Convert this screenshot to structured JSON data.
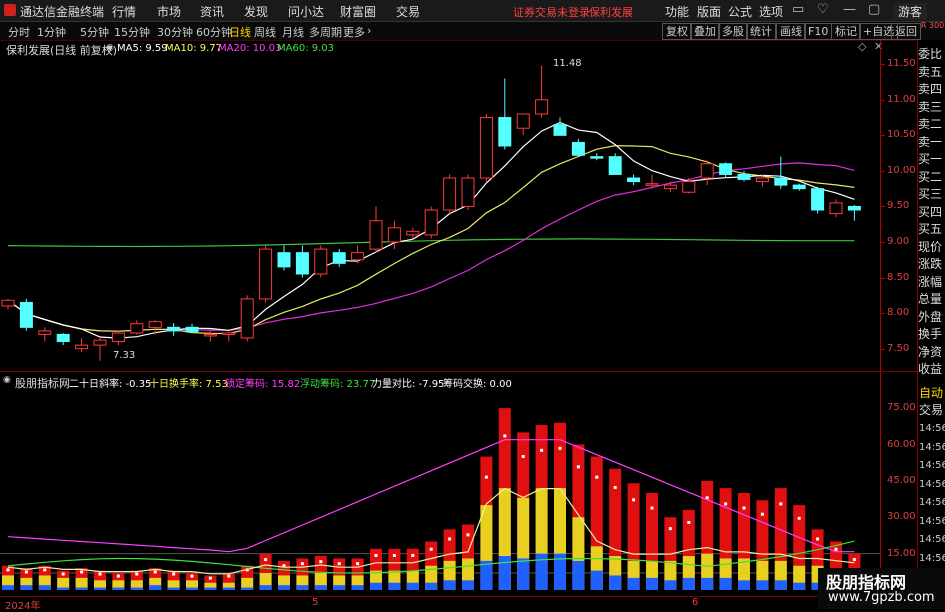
{
  "app": {
    "title": "通达信金融终端",
    "menu": [
      "行情",
      "市场",
      "资讯",
      "发现",
      "问小达",
      "财富圈",
      "交易"
    ],
    "login_warning": "证券交易未登录",
    "stock_link": "保利发展",
    "right_menu": [
      "功能",
      "版面",
      "公式",
      "选项"
    ],
    "guest": "游客",
    "win_buttons": [
      "▭",
      "♡",
      "—",
      "▢",
      "✕"
    ]
  },
  "periods": {
    "items": [
      "分时",
      "1分钟",
      "5分钟",
      "15分钟",
      "30分钟",
      "60分钟",
      "日线",
      "周线",
      "月线",
      "多周期",
      "更多"
    ],
    "active": "日线",
    "tools": [
      "复权",
      "叠加",
      "多股",
      "统计",
      "画线",
      "F10",
      "标记",
      "+自选",
      "返回"
    ],
    "corner_badge": "R 300"
  },
  "main_chart": {
    "title": "保利发展(日线 前复权)",
    "ma_labels": [
      {
        "text": "MA5: 9.59",
        "color": "#ffffff"
      },
      {
        "text": "MA10: 9.77",
        "color": "#ffff50"
      },
      {
        "text": "MA20: 10.03",
        "color": "#ff40ff"
      },
      {
        "text": "MA60: 9.03",
        "color": "#40e040"
      }
    ],
    "high_label": "11.48",
    "low_label": "7.33",
    "y_ticks": [
      "11.50",
      "11.00",
      "10.50",
      "10.00",
      "9.50",
      "9.00",
      "8.50",
      "8.00",
      "7.50"
    ]
  },
  "indicator": {
    "title": "股朋指标网",
    "items": [
      {
        "text": "二十日斜率: -0.35",
        "color": "#ffffff"
      },
      {
        "text": "十日换手率: 7.53",
        "color": "#ffff50"
      },
      {
        "text": "锁定筹码: 15.82",
        "color": "#ff40ff"
      },
      {
        "text": "浮动筹码: 23.77",
        "color": "#40e040"
      },
      {
        "text": "力量对比: -7.95",
        "color": "#ffffff"
      },
      {
        "text": "筹码交换: 0.00",
        "color": "#ffffff"
      }
    ],
    "y_ticks": [
      "75.00",
      "60.00",
      "45.00",
      "30.00",
      "15.00"
    ]
  },
  "xaxis": {
    "labels": [
      "2024年",
      "5",
      "6"
    ]
  },
  "side_panel": {
    "labels": [
      "委比",
      "卖五",
      "卖四",
      "卖三",
      "卖二",
      "卖一",
      "买一",
      "买二",
      "买三",
      "买四",
      "买五",
      "现价",
      "涨跌",
      "涨幅",
      "总量",
      "外盘",
      "换手",
      "净资",
      "收益"
    ],
    "mode": "自动",
    "trade": "交易",
    "times": [
      "14:56",
      "14:56",
      "14:56",
      "14:56",
      "14:56",
      "14:56",
      "14:56",
      "14:56"
    ]
  },
  "watermark": {
    "title": "股朋指标网",
    "url": "www.7gpzb.com"
  },
  "chart_data": {
    "type": "candlestick",
    "price_candles": [
      {
        "o": 8.1,
        "h": 8.2,
        "l": 8.05,
        "c": 8.18
      },
      {
        "o": 8.15,
        "h": 8.2,
        "l": 7.75,
        "c": 7.8
      },
      {
        "o": 7.7,
        "h": 7.8,
        "l": 7.6,
        "c": 7.75
      },
      {
        "o": 7.7,
        "h": 7.72,
        "l": 7.55,
        "c": 7.6
      },
      {
        "o": 7.5,
        "h": 7.65,
        "l": 7.45,
        "c": 7.55
      },
      {
        "o": 7.55,
        "h": 7.66,
        "l": 7.33,
        "c": 7.62
      },
      {
        "o": 7.6,
        "h": 7.75,
        "l": 7.55,
        "c": 7.72
      },
      {
        "o": 7.72,
        "h": 7.9,
        "l": 7.7,
        "c": 7.85
      },
      {
        "o": 7.8,
        "h": 7.9,
        "l": 7.7,
        "c": 7.88
      },
      {
        "o": 7.8,
        "h": 7.86,
        "l": 7.68,
        "c": 7.75
      },
      {
        "o": 7.8,
        "h": 7.85,
        "l": 7.72,
        "c": 7.74
      },
      {
        "o": 7.7,
        "h": 7.76,
        "l": 7.6,
        "c": 7.7
      },
      {
        "o": 7.7,
        "h": 7.74,
        "l": 7.6,
        "c": 7.72
      },
      {
        "o": 7.65,
        "h": 8.25,
        "l": 7.6,
        "c": 8.2
      },
      {
        "o": 8.2,
        "h": 8.95,
        "l": 8.15,
        "c": 8.9
      },
      {
        "o": 8.85,
        "h": 8.95,
        "l": 8.6,
        "c": 8.65
      },
      {
        "o": 8.85,
        "h": 8.95,
        "l": 8.5,
        "c": 8.55
      },
      {
        "o": 8.55,
        "h": 8.95,
        "l": 8.5,
        "c": 8.9
      },
      {
        "o": 8.85,
        "h": 8.9,
        "l": 8.65,
        "c": 8.7
      },
      {
        "o": 8.75,
        "h": 8.95,
        "l": 8.7,
        "c": 8.85
      },
      {
        "o": 8.9,
        "h": 9.5,
        "l": 8.85,
        "c": 9.3
      },
      {
        "o": 9.0,
        "h": 9.3,
        "l": 8.9,
        "c": 9.2
      },
      {
        "o": 9.1,
        "h": 9.2,
        "l": 9.05,
        "c": 9.15
      },
      {
        "o": 9.1,
        "h": 9.5,
        "l": 9.05,
        "c": 9.45
      },
      {
        "o": 9.45,
        "h": 9.95,
        "l": 9.4,
        "c": 9.9
      },
      {
        "o": 9.5,
        "h": 9.95,
        "l": 9.45,
        "c": 9.9
      },
      {
        "o": 9.9,
        "h": 10.8,
        "l": 9.85,
        "c": 10.75
      },
      {
        "o": 10.75,
        "h": 11.3,
        "l": 10.3,
        "c": 10.35
      },
      {
        "o": 10.6,
        "h": 10.8,
        "l": 10.5,
        "c": 10.8
      },
      {
        "o": 10.8,
        "h": 11.48,
        "l": 10.75,
        "c": 11.0
      },
      {
        "o": 10.65,
        "h": 10.75,
        "l": 10.5,
        "c": 10.5
      },
      {
        "o": 10.4,
        "h": 10.45,
        "l": 10.2,
        "c": 10.22
      },
      {
        "o": 10.2,
        "h": 10.25,
        "l": 10.15,
        "c": 10.18
      },
      {
        "o": 10.2,
        "h": 10.25,
        "l": 9.95,
        "c": 9.95
      },
      {
        "o": 9.9,
        "h": 9.95,
        "l": 9.8,
        "c": 9.85
      },
      {
        "o": 9.8,
        "h": 9.95,
        "l": 9.75,
        "c": 9.82
      },
      {
        "o": 9.75,
        "h": 9.85,
        "l": 9.7,
        "c": 9.8
      },
      {
        "o": 9.7,
        "h": 9.9,
        "l": 9.68,
        "c": 9.85
      },
      {
        "o": 9.9,
        "h": 10.15,
        "l": 9.8,
        "c": 10.1
      },
      {
        "o": 10.1,
        "h": 10.12,
        "l": 9.9,
        "c": 9.95
      },
      {
        "o": 9.95,
        "h": 10.0,
        "l": 9.85,
        "c": 9.88
      },
      {
        "o": 9.85,
        "h": 9.95,
        "l": 9.78,
        "c": 9.9
      },
      {
        "o": 9.9,
        "h": 10.2,
        "l": 9.75,
        "c": 9.8
      },
      {
        "o": 9.8,
        "h": 9.82,
        "l": 9.72,
        "c": 9.75
      },
      {
        "o": 9.75,
        "h": 9.78,
        "l": 9.4,
        "c": 9.45
      },
      {
        "o": 9.4,
        "h": 9.6,
        "l": 9.35,
        "c": 9.55
      },
      {
        "o": 9.5,
        "h": 9.52,
        "l": 9.3,
        "c": 9.45
      }
    ],
    "price_ylim": [
      7.2,
      11.7
    ],
    "indicator_bars": [
      {
        "r": 10,
        "y": 6,
        "b": 2
      },
      {
        "r": 9,
        "y": 5,
        "b": 2
      },
      {
        "r": 10,
        "y": 6,
        "b": 2
      },
      {
        "r": 8,
        "y": 5,
        "b": 1
      },
      {
        "r": 9,
        "y": 5,
        "b": 1
      },
      {
        "r": 8,
        "y": 4,
        "b": 1
      },
      {
        "r": 7,
        "y": 4,
        "b": 1
      },
      {
        "r": 8,
        "y": 4,
        "b": 1
      },
      {
        "r": 9,
        "y": 5,
        "b": 2
      },
      {
        "r": 8,
        "y": 4,
        "b": 1
      },
      {
        "r": 7,
        "y": 4,
        "b": 1
      },
      {
        "r": 6,
        "y": 3,
        "b": 1
      },
      {
        "r": 7,
        "y": 3,
        "b": 1
      },
      {
        "r": 10,
        "y": 5,
        "b": 1
      },
      {
        "r": 15,
        "y": 7,
        "b": 2
      },
      {
        "r": 12,
        "y": 6,
        "b": 2
      },
      {
        "r": 13,
        "y": 6,
        "b": 2
      },
      {
        "r": 14,
        "y": 7,
        "b": 2
      },
      {
        "r": 13,
        "y": 6,
        "b": 2
      },
      {
        "r": 13,
        "y": 6,
        "b": 2
      },
      {
        "r": 17,
        "y": 8,
        "b": 3
      },
      {
        "r": 17,
        "y": 8,
        "b": 3
      },
      {
        "r": 17,
        "y": 8,
        "b": 3
      },
      {
        "r": 20,
        "y": 10,
        "b": 3
      },
      {
        "r": 25,
        "y": 12,
        "b": 4
      },
      {
        "r": 27,
        "y": 13,
        "b": 4
      },
      {
        "r": 55,
        "y": 35,
        "b": 12
      },
      {
        "r": 75,
        "y": 42,
        "b": 14
      },
      {
        "r": 65,
        "y": 38,
        "b": 13
      },
      {
        "r": 68,
        "y": 42,
        "b": 15
      },
      {
        "r": 69,
        "y": 42,
        "b": 15
      },
      {
        "r": 60,
        "y": 30,
        "b": 12
      },
      {
        "r": 55,
        "y": 18,
        "b": 8
      },
      {
        "r": 50,
        "y": 14,
        "b": 6
      },
      {
        "r": 44,
        "y": 12,
        "b": 5
      },
      {
        "r": 40,
        "y": 12,
        "b": 5
      },
      {
        "r": 30,
        "y": 12,
        "b": 4
      },
      {
        "r": 33,
        "y": 14,
        "b": 5
      },
      {
        "r": 45,
        "y": 15,
        "b": 5
      },
      {
        "r": 42,
        "y": 13,
        "b": 5
      },
      {
        "r": 40,
        "y": 13,
        "b": 4
      },
      {
        "r": 37,
        "y": 12,
        "b": 4
      },
      {
        "r": 42,
        "y": 12,
        "b": 4
      },
      {
        "r": 35,
        "y": 10,
        "b": 3
      },
      {
        "r": 25,
        "y": 10,
        "b": 3
      },
      {
        "r": 20,
        "y": 9,
        "b": 3
      },
      {
        "r": 15,
        "y": 8,
        "b": 2
      }
    ],
    "indicator_ylim": [
      0,
      80
    ]
  }
}
